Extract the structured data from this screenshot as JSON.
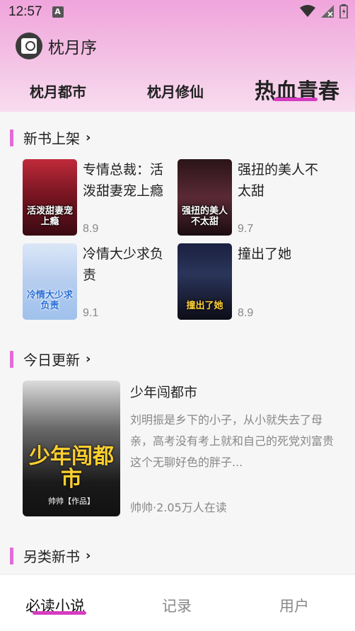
{
  "status_bar": {
    "time": "12:57",
    "notification_icon": "A",
    "icons": [
      "wifi-icon",
      "signal-icon",
      "battery-icon"
    ]
  },
  "app": {
    "title": "枕月序",
    "logo_icon": "app-logo-icon"
  },
  "tabs": [
    {
      "label": "枕月都市",
      "active": false
    },
    {
      "label": "枕月修仙",
      "active": false
    },
    {
      "label": "热血青春",
      "active": true
    }
  ],
  "sections": {
    "new_books": {
      "label": "新书上架",
      "books": [
        {
          "title": "专情总裁：活泼甜妻宠上瘾",
          "score": "8.9",
          "cover_text": "活泼甜妻宠上瘾"
        },
        {
          "title": "强扭的美人不太甜",
          "score": "9.7",
          "cover_text": "强扭的美人不太甜"
        },
        {
          "title": "冷情大少求负责",
          "score": "9.1",
          "cover_text": "冷情大少求负责"
        },
        {
          "title": "撞出了她",
          "score": "8.9",
          "cover_text": "撞出了她"
        }
      ]
    },
    "today_update": {
      "label": "今日更新",
      "book": {
        "title": "少年闯都市",
        "description": "刘明振是乡下的小子，从小就失去了母亲，高考没有考上就和自己的死党刘富贵这个无聊好色的胖子...",
        "meta": "帅帅·2.05万人在读",
        "cover_title": "少年闯都市",
        "cover_sub": "帅帅【作品】"
      }
    },
    "other": {
      "label": "另类新书"
    }
  },
  "bottom_nav": [
    {
      "label": "必读小说",
      "active": true
    },
    {
      "label": "记录",
      "active": false
    },
    {
      "label": "用户",
      "active": false
    }
  ],
  "colors": {
    "accent": "#d63cc1",
    "section_bar": "#e46bd6",
    "header_gradient_top": "#f0a4dc"
  }
}
